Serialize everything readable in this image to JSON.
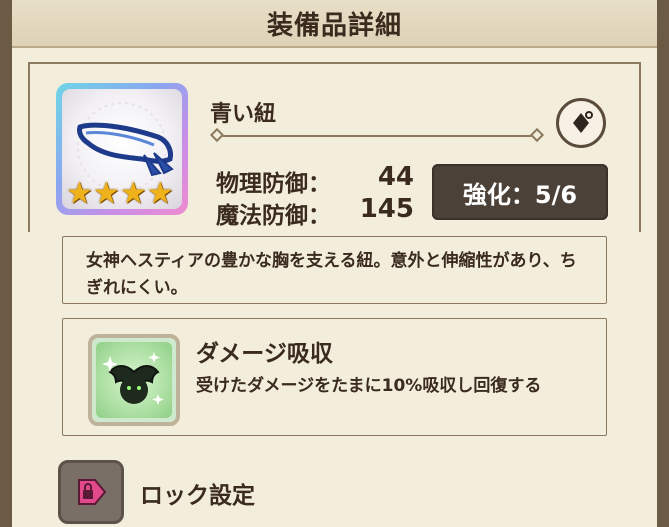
{
  "header": {
    "title": "装備品詳細"
  },
  "item": {
    "name": "青い紐",
    "rarity_stars": 4,
    "stats": [
      {
        "label": "物理防御：",
        "value": "44"
      },
      {
        "label": "魔法防御：",
        "value": "145"
      }
    ],
    "enhance_label": "強化：5/6",
    "description": "女神ヘスティアの豊かな胸を支える紐。意外と伸縮性があり、ちぎれにくい。"
  },
  "skill": {
    "name": "ダメージ吸収",
    "description": "受けたダメージをたまに10%吸収し回復する"
  },
  "lock": {
    "label": "ロック設定"
  },
  "icons": {
    "item": "blue-ribbon-icon",
    "skill": "bat-sparkle-icon",
    "lock": "lock-tag-icon",
    "share": "earring-icon"
  },
  "colors": {
    "panel_bg": "#f3eddc",
    "enhance_bg": "#4b4138",
    "star": "#f0b21a",
    "lock_accent": "#e04a8a"
  }
}
